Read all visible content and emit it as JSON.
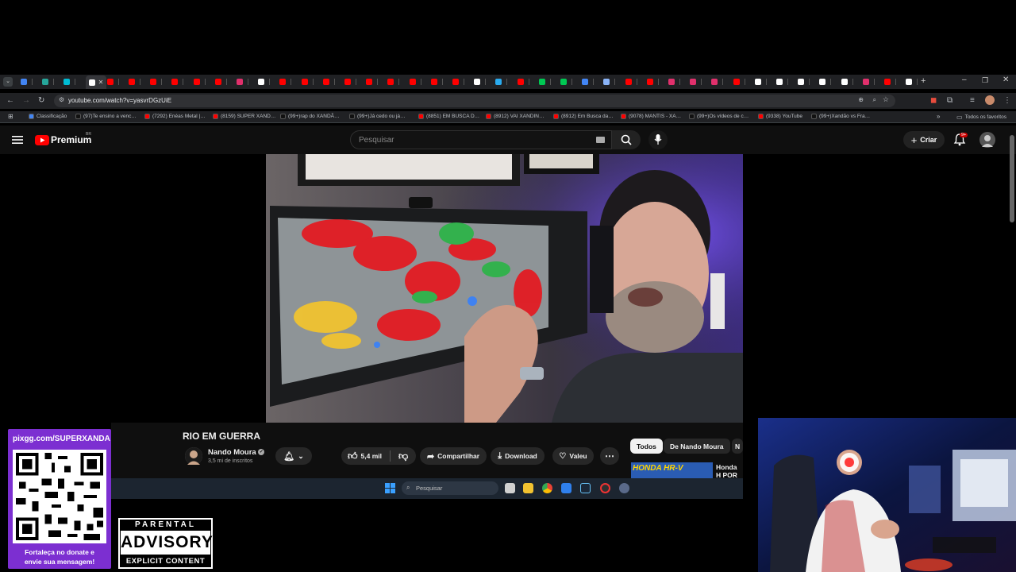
{
  "browser": {
    "url": "youtube.com/watch?v=yasvrDGzUiE",
    "tab_count": 42,
    "bookmarks": [
      {
        "label": "Classificação",
        "color": "#4285f4"
      },
      {
        "label": "(97)Te ensino a venc…",
        "color": "#111111"
      },
      {
        "label": "(7292) Enéas Metal |…",
        "color": "#ff0000"
      },
      {
        "label": "(8159) SUPER XAND…",
        "color": "#ff0000"
      },
      {
        "label": "(99+)rap do XANDÃ…",
        "color": "#111111"
      },
      {
        "label": "(99+)Já cedo ou já…",
        "color": "#111111"
      },
      {
        "label": "(8851) EM BUSCA D…",
        "color": "#ff0000"
      },
      {
        "label": "(8912) VAI XANDIN…",
        "color": "#ff0000"
      },
      {
        "label": "(8912) Em Busca da…",
        "color": "#ff0000"
      },
      {
        "label": "(9078) MANTIS - XA…",
        "color": "#ff0000"
      },
      {
        "label": "(99+)Os vídeos de c…",
        "color": "#111111"
      },
      {
        "label": "(9338) YouTube",
        "color": "#ff0000"
      },
      {
        "label": "(99+)Xandão vs Fra…",
        "color": "#111111"
      }
    ],
    "all_bookmarks_label": "Todos os favoritos"
  },
  "youtube": {
    "logo_label": "Premium",
    "logo_region": "BR",
    "search_placeholder": "Pesquisar",
    "create_label": "Criar",
    "notification_badge": "9+",
    "video_title": "RIO EM GUERRA",
    "channel_name": "Nando Moura",
    "channel_subs": "3,5 mi de inscritos",
    "likes": "5,4 mil",
    "share_label": "Compartilhar",
    "download_label": "Download",
    "thanks_label": "Valeu",
    "chips": [
      "Todos",
      "De Nando Moura",
      "N"
    ],
    "rec_title": "Honda H POR QU",
    "rec_thumb_text": "HONDA HR-V"
  },
  "taskbar": {
    "search_placeholder": "Pesquisar"
  },
  "overlay": {
    "qr_url": "pixgg.com/SUPERXANDA",
    "qr_caption_1": "Fortaleça no donate e",
    "qr_caption_2": "envie sua mensagem!",
    "advisory_top": "PARENTAL",
    "advisory_mid": "ADVISORY",
    "advisory_bottom": "EXPLICIT CONTENT"
  },
  "colors": {
    "yt_red": "#ff0000",
    "background": "#0f0f0f",
    "qr_panel": "#7c2fd1"
  }
}
